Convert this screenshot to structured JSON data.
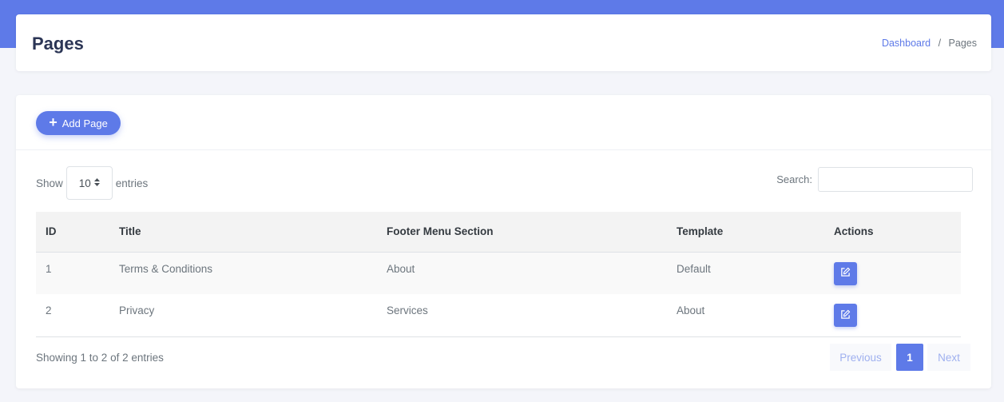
{
  "header": {
    "title": "Pages",
    "breadcrumb": {
      "home": "Dashboard",
      "separator": "/",
      "current": "Pages"
    }
  },
  "toolbar": {
    "add_label": "Add Page",
    "add_icon": "plus-icon"
  },
  "length": {
    "show_label": "Show",
    "value": "10",
    "entries_label": "entries"
  },
  "search": {
    "label": "Search:",
    "value": "",
    "placeholder": ""
  },
  "table": {
    "columns": [
      "ID",
      "Title",
      "Footer Menu Section",
      "Template",
      "Actions"
    ],
    "rows": [
      {
        "id": "1",
        "title": "Terms & Conditions",
        "section": "About",
        "template": "Default"
      },
      {
        "id": "2",
        "title": "Privacy",
        "section": "Services",
        "template": "About"
      }
    ]
  },
  "footer": {
    "info": "Showing 1 to 2 of 2 entries",
    "previous": "Previous",
    "current_page": "1",
    "next": "Next"
  },
  "colors": {
    "accent": "#5e7ae8",
    "background": "#f4f5fa",
    "title": "#2b3555"
  }
}
